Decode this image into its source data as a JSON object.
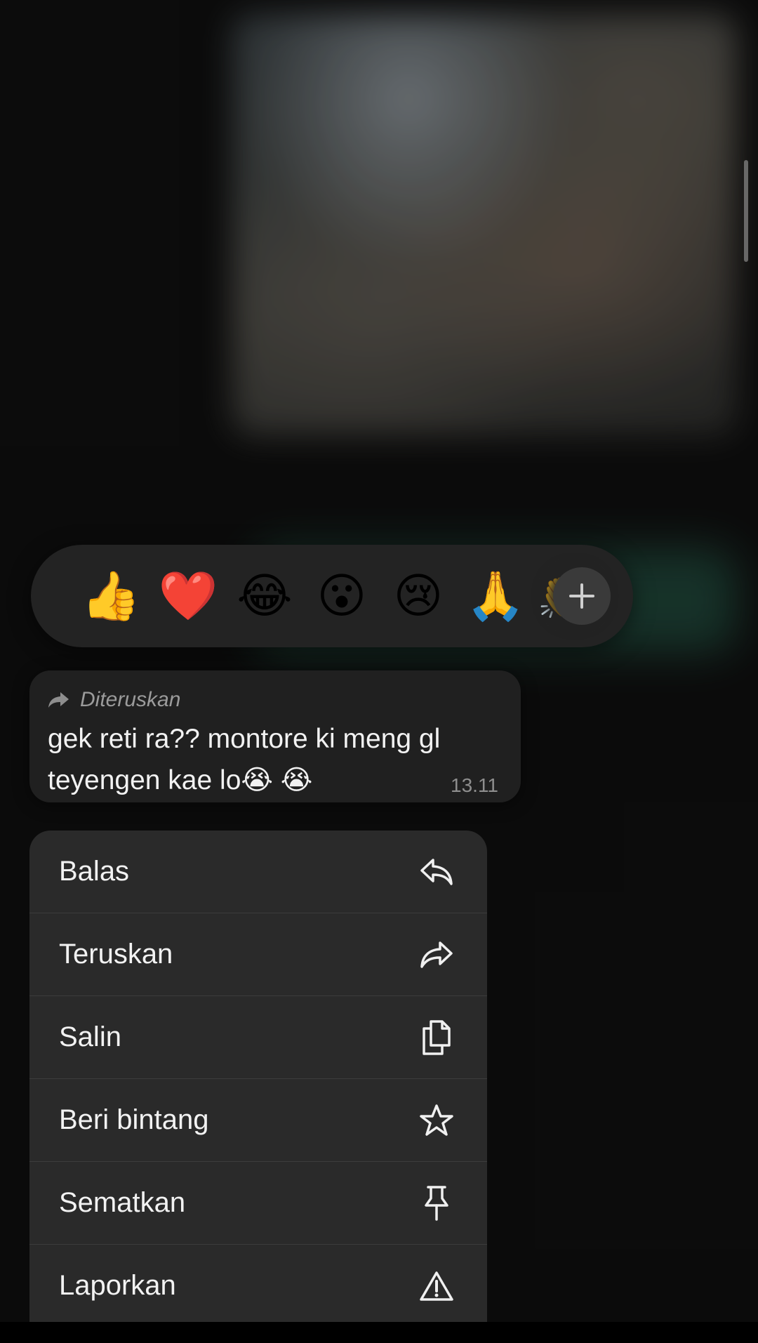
{
  "reactions": {
    "items": [
      {
        "emoji": "👍",
        "name": "thumbs-up"
      },
      {
        "emoji": "❤️",
        "name": "red-heart"
      },
      {
        "emoji": "😂",
        "name": "tears-of-joy"
      },
      {
        "emoji": "😮",
        "name": "surprised"
      },
      {
        "emoji": "😢",
        "name": "crying"
      },
      {
        "emoji": "🙏",
        "name": "folded-hands"
      },
      {
        "emoji": "👏",
        "name": "clapping-hands"
      }
    ],
    "more_icon": "plus-icon"
  },
  "message": {
    "forwarded_label": "Diteruskan",
    "forwarded_icon": "forward-arrow-icon",
    "text": "gek reti ra?? montore ki meng gl teyengen kae lo😭 😭",
    "time": "13.11"
  },
  "menu": {
    "items": [
      {
        "label": "Balas",
        "icon": "reply-icon"
      },
      {
        "label": "Teruskan",
        "icon": "forward-icon"
      },
      {
        "label": "Salin",
        "icon": "copy-icon"
      },
      {
        "label": "Beri bintang",
        "icon": "star-icon"
      },
      {
        "label": "Sematkan",
        "icon": "pin-icon"
      },
      {
        "label": "Laporkan",
        "icon": "warning-icon"
      }
    ]
  },
  "colors": {
    "background": "#0e0e0e",
    "bubble": "#202020",
    "menu": "#2a2a2a",
    "text": "#f2f2f2",
    "muted": "#9b9b9b"
  }
}
